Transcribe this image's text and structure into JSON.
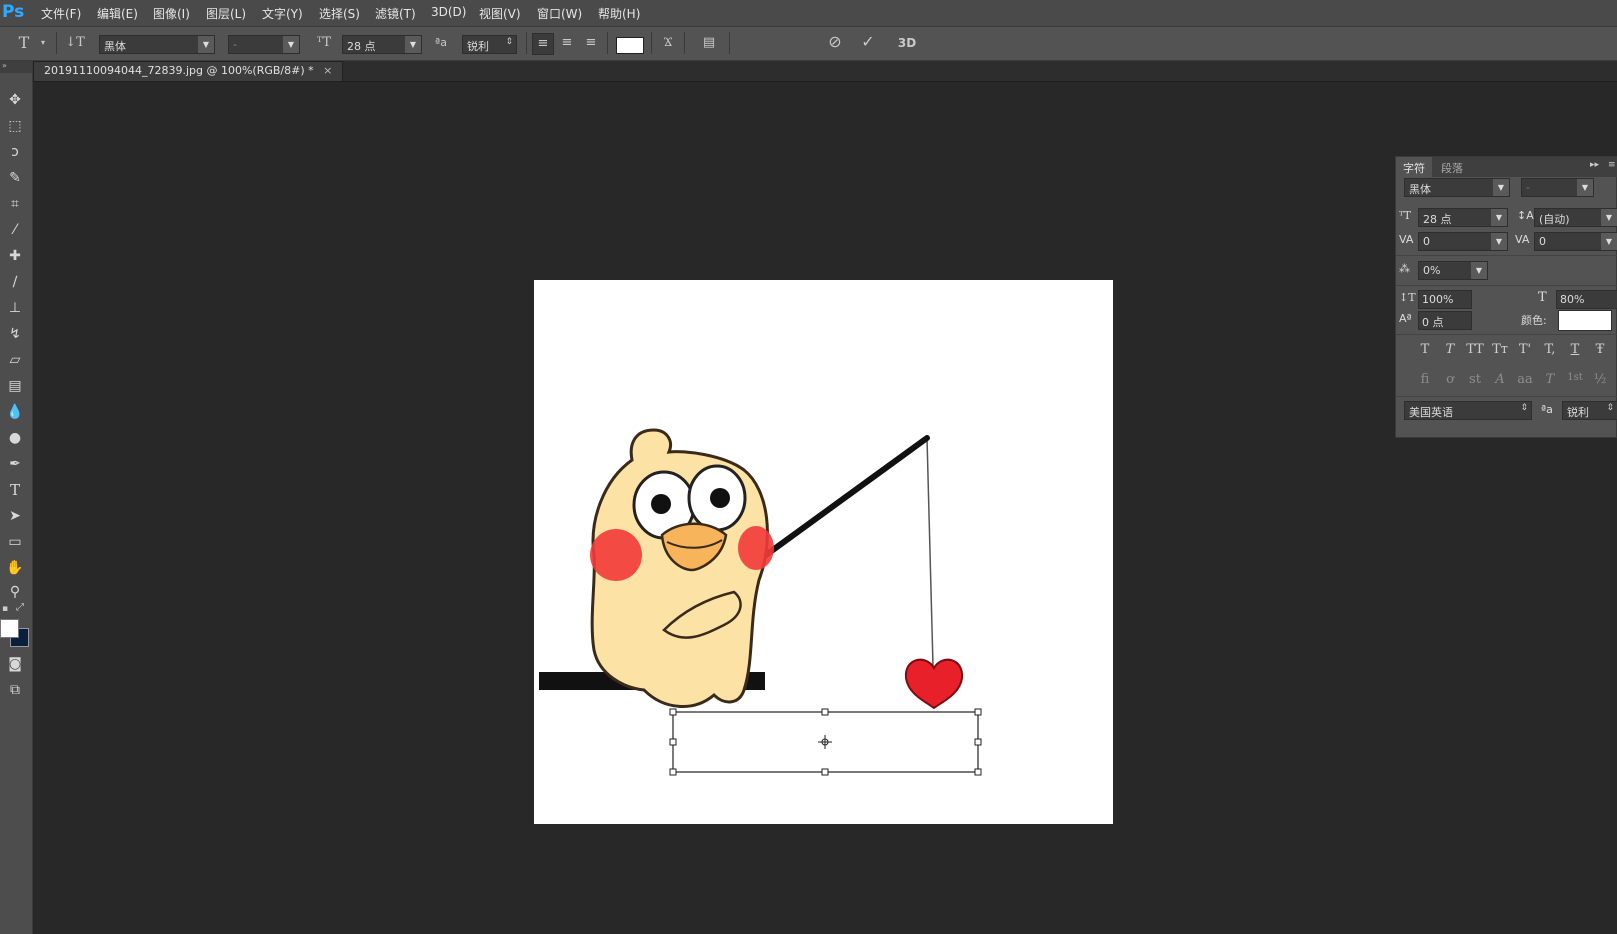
{
  "app": {
    "logo": "Ps"
  },
  "menu": [
    "文件(F)",
    "编辑(E)",
    "图像(I)",
    "图层(L)",
    "文字(Y)",
    "选择(S)",
    "滤镜(T)",
    "3D(D)",
    "视图(V)",
    "窗口(W)",
    "帮助(H)"
  ],
  "options": {
    "font_family": "黑体",
    "font_style": "-",
    "font_size": "28 点",
    "antialias": "锐利",
    "three_d_label": "3D",
    "text_color": "#ffffff"
  },
  "document_tab": {
    "title": "20191110094044_72839.jpg @ 100%(RGB/8#) *",
    "close": "×"
  },
  "character_panel": {
    "tabs": [
      "字符",
      "段落"
    ],
    "font_family": "黑体",
    "font_style": "-",
    "font_size": "28 点",
    "leading": "(自动)",
    "kerning": "0",
    "tracking": "0",
    "tsume": "0%",
    "vertical_scale": "100%",
    "horizontal_scale": "80%",
    "baseline_shift": "0 点",
    "color_label": "颜色:",
    "color": "#ffffff",
    "style_buttons": [
      "T",
      "T",
      "TT",
      "Tт",
      "T'",
      "T,",
      "T",
      "Ŧ"
    ],
    "opentype_buttons": [
      "fi",
      "ơ",
      "st",
      "A",
      "aa",
      "T",
      "1st",
      "½"
    ],
    "language": "美国英语",
    "aa_label": "ªa",
    "antialias": "锐利"
  },
  "colors": {
    "foreground": "#ffffff",
    "background": "#0a1f3d",
    "logo": "#31a8ff"
  }
}
